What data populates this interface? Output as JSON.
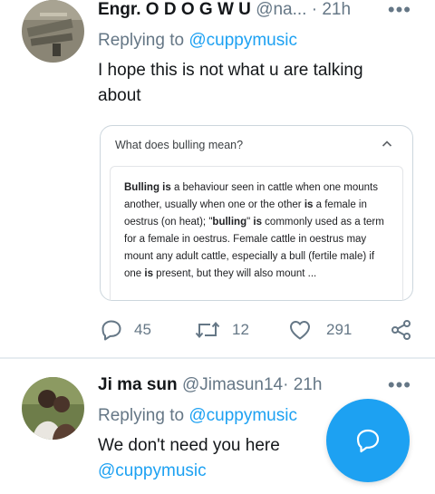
{
  "tweets": [
    {
      "name": "Engr. O D O G W U",
      "handle": "@na...",
      "time": "· 21h",
      "replying_prefix": "Replying to",
      "replying_to": "@cuppymusic",
      "text": "I hope this is not what u are talking about",
      "card": {
        "question": "What does bulling mean?",
        "snippet_parts": [
          {
            "t": "Bulling is",
            "b": true
          },
          {
            "t": " a behaviour seen in cattle when one mounts another, usually when one or the other ",
            "b": false
          },
          {
            "t": "is",
            "b": true
          },
          {
            "t": " a female in oestrus (on heat); \"",
            "b": false
          },
          {
            "t": "bulling",
            "b": true
          },
          {
            "t": "\" ",
            "b": false
          },
          {
            "t": "is",
            "b": true
          },
          {
            "t": " commonly used as a term for a female in oestrus. Female cattle in oestrus may mount any adult cattle, especially a bull (fertile male) if one ",
            "b": false
          },
          {
            "t": "is",
            "b": true
          },
          {
            "t": " present, but they will also mount ...",
            "b": false
          }
        ]
      },
      "actions": {
        "replies": "45",
        "retweets": "12",
        "likes": "291"
      }
    },
    {
      "name": "Ji ma sun",
      "handle": "@Jimasun14",
      "time": "· 21h",
      "replying_prefix": "Replying to",
      "replying_to": "@cuppymusic",
      "text": "We don't need you here",
      "text_mention": "@cuppymusic"
    }
  ],
  "icons": {
    "more": "more-horizontal-icon",
    "reply": "reply-icon",
    "retweet": "retweet-icon",
    "like": "heart-icon",
    "share": "share-icon",
    "chevron": "chevron-up-icon",
    "compose": "compose-reply-icon"
  },
  "colors": {
    "accent": "#1da1f2",
    "secondary_text": "#657786",
    "text": "#14171a"
  }
}
